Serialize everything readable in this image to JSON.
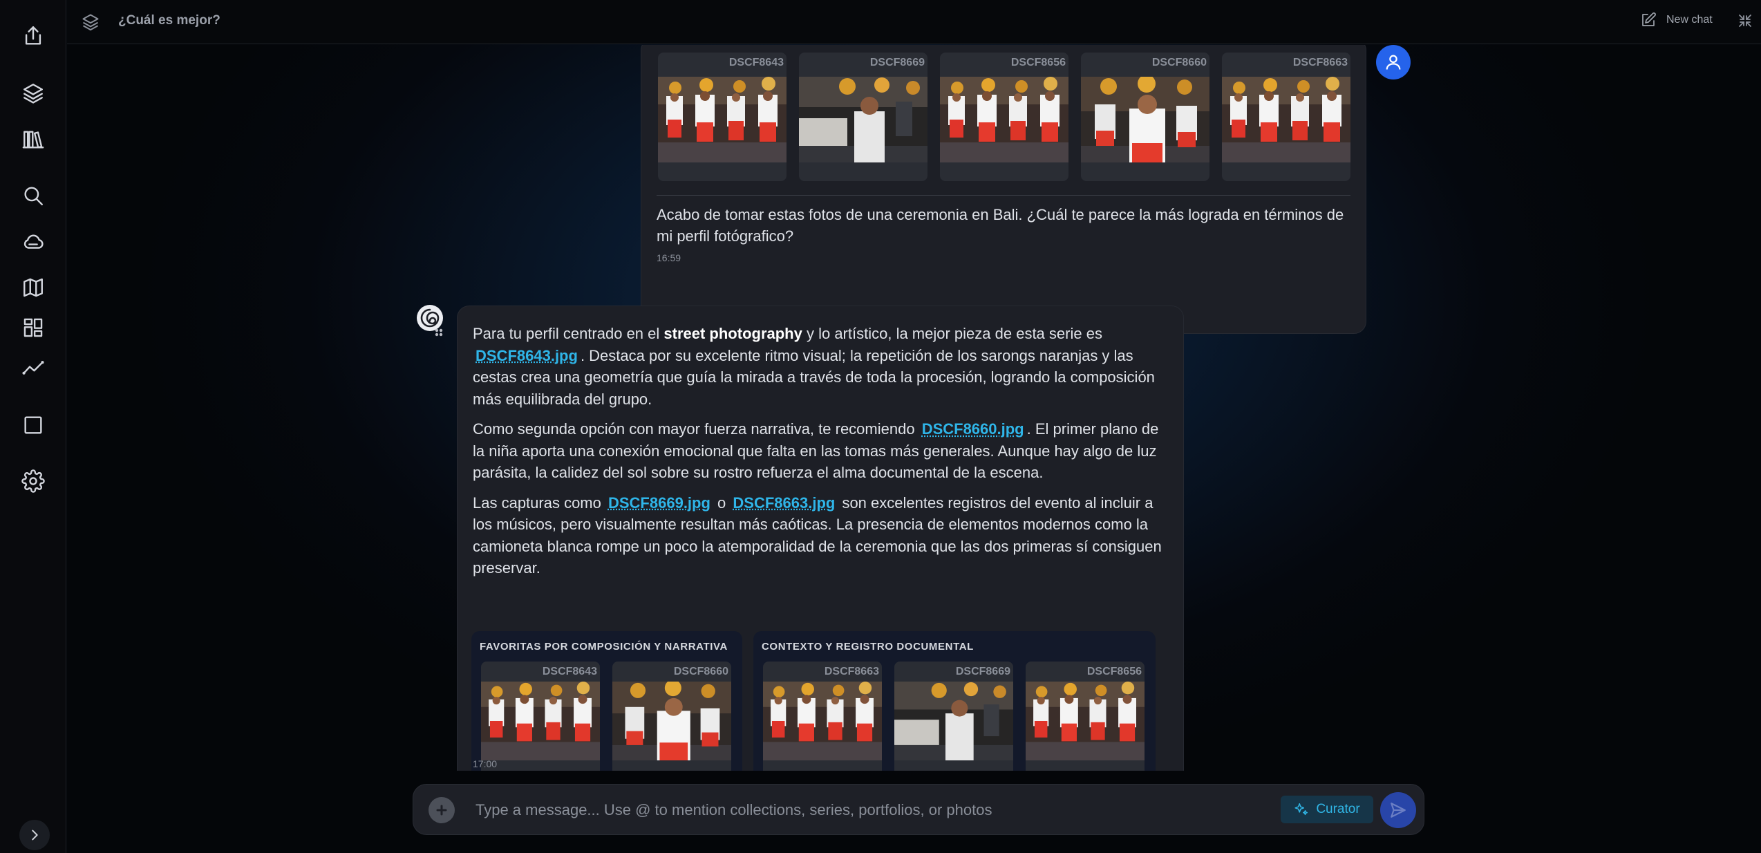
{
  "header": {
    "title": "¿Cuál es mejor?",
    "new_chat_label": "New chat"
  },
  "sidebar": {
    "items": [
      {
        "icon": "share-icon"
      },
      {
        "icon": "layers-icon"
      },
      {
        "icon": "library-icon"
      },
      {
        "icon": "search-icon"
      },
      {
        "icon": "cloud-icon"
      },
      {
        "icon": "map-icon"
      },
      {
        "icon": "dashboard-icon"
      },
      {
        "icon": "analytics-icon"
      },
      {
        "icon": "square-icon"
      },
      {
        "icon": "settings-icon"
      }
    ]
  },
  "user_message": {
    "photos": [
      "DSCF8643",
      "DSCF8669",
      "DSCF8656",
      "DSCF8660",
      "DSCF8663"
    ],
    "text": "Acabo de tomar estas fotos de una ceremonia en Bali. ¿Cuál te parece la más lograda en términos de mi perfil fotógrafico?",
    "time": "16:59"
  },
  "bot_message": {
    "p1_a": "Para tu perfil centrado en el ",
    "p1_bold": "street photography",
    "p1_b": " y lo artístico, la mejor pieza de esta serie es ",
    "p1_link": "DSCF8643.jpg",
    "p1_c": ". Destaca por su excelente ritmo visual; la repetición de los sarongs naranjas y las cestas crea una geometría que guía la mirada a través de toda la procesión, logrando la composición más equilibrada del grupo.",
    "p2_a": "Como segunda opción con mayor fuerza narrativa, te recomiendo ",
    "p2_link": "DSCF8660.jpg",
    "p2_b": ". El primer plano de la niña aporta una conexión emocional que falta en las tomas más generales. Aunque hay algo de luz parásita, la calidez del sol sobre su rostro refuerza el alma documental de la escena.",
    "p3_a": "Las capturas como ",
    "p3_link1": "DSCF8669.jpg",
    "p3_mid": " o ",
    "p3_link2": "DSCF8663.jpg",
    "p3_b": " son excelentes registros del evento al incluir a los músicos, pero visualmente resultan más caóticas. La presencia de elementos modernos como la camioneta blanca rompe un poco la atemporalidad de la ceremonia que las dos primeras sí consiguen preservar.",
    "groups": [
      {
        "title": "FAVORITAS POR COMPOSICIÓN Y NARRATIVA",
        "photos": [
          "DSCF8643",
          "DSCF8660"
        ]
      },
      {
        "title": "CONTEXTO Y REGISTRO DOCUMENTAL",
        "photos": [
          "DSCF8663",
          "DSCF8669",
          "DSCF8656"
        ]
      }
    ],
    "time": "17:00"
  },
  "input": {
    "placeholder": "Type a message... Use @ to mention collections, series, portfolios, or photos",
    "curator_label": "Curator"
  },
  "colors": {
    "accent": "#2fb5e8",
    "user_avatar": "#2563eb",
    "send_button": "#2845a8"
  }
}
